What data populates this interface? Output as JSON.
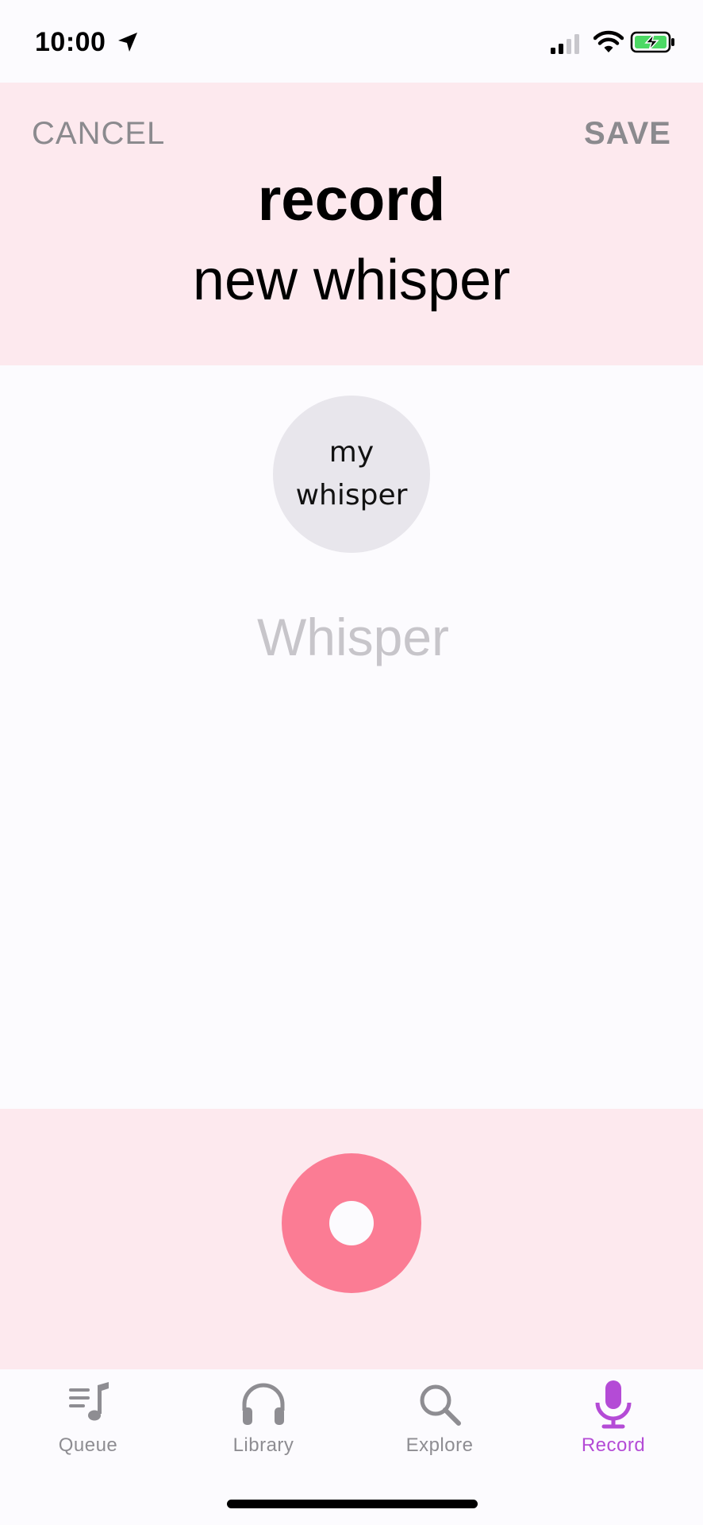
{
  "status_bar": {
    "time": "10:00"
  },
  "header": {
    "cancel_label": "CANCEL",
    "save_label": "SAVE",
    "title_line1": "record",
    "title_line2": "new whisper"
  },
  "main": {
    "avatar_text": "my\nwhisper",
    "whisper_input": {
      "value": "",
      "placeholder": "Whisper"
    }
  },
  "record": {
    "button_color": "#fb7c94"
  },
  "tab_bar": {
    "tabs": [
      {
        "label": "Queue",
        "icon": "music-queue-icon",
        "active": false
      },
      {
        "label": "Library",
        "icon": "headphones-icon",
        "active": false
      },
      {
        "label": "Explore",
        "icon": "search-icon",
        "active": false
      },
      {
        "label": "Record",
        "icon": "microphone-icon",
        "active": true
      }
    ]
  },
  "colors": {
    "header_bg": "#fde9ee",
    "accent": "#b44bd6",
    "muted_text": "#8b8a8e",
    "battery_green": "#4cd964"
  }
}
